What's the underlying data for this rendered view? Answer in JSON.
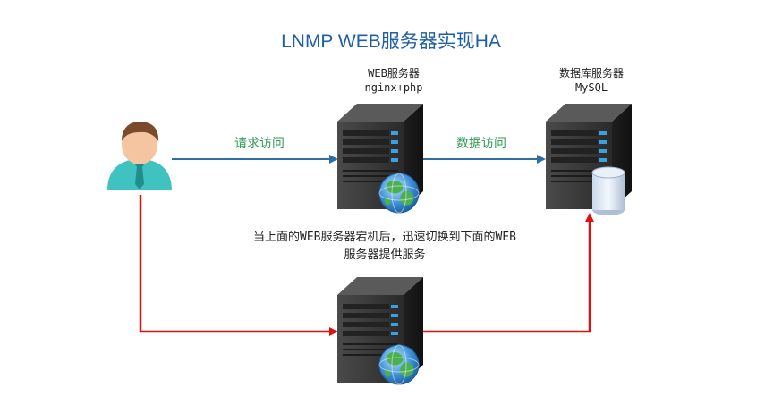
{
  "title": "LNMP WEB服务器实现HA",
  "nodes": {
    "web_primary": {
      "line1": "WEB服务器",
      "line2": "nginx+php"
    },
    "database": {
      "line1": "数据库服务器",
      "line2": "MySQL"
    }
  },
  "edges": {
    "request": "请求访问",
    "data_access": "数据访问"
  },
  "note": {
    "line1": "当上面的WEB服务器宕机后，迅速切换到下面的WEB",
    "line2": "服务器提供服务"
  },
  "colors": {
    "title": "#1f5fa6",
    "primary_arrow": "#2e6fa3",
    "failover_arrow": "#e01010",
    "edge_label": "#2f9a52",
    "server_body": "#3a3a3a",
    "server_led": "#3aa0e0"
  },
  "icons": [
    "user-icon",
    "server-icon",
    "globe-icon",
    "database-cylinder-icon"
  ]
}
